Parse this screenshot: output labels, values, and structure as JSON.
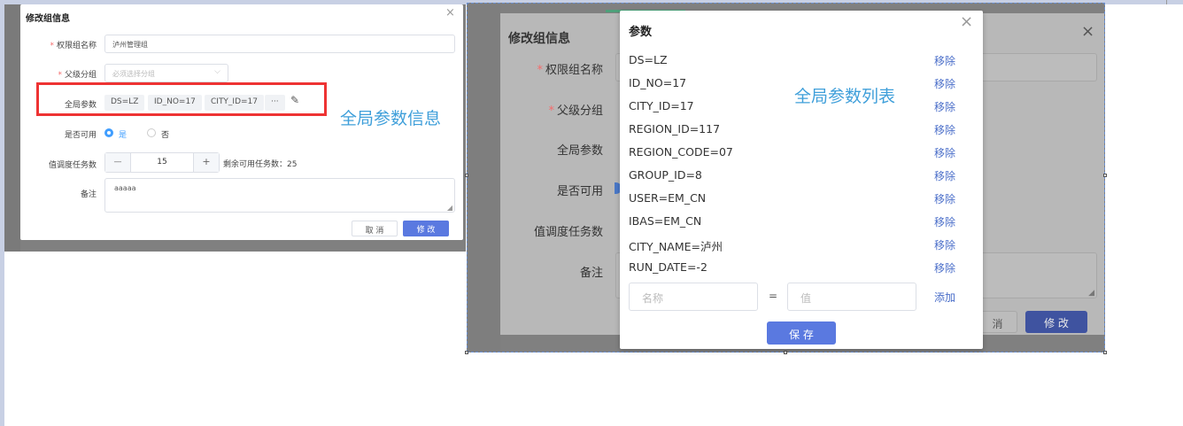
{
  "left_dialog": {
    "title": "修改组信息",
    "close_icon": "×",
    "name_label": "权限组名称",
    "name_value": "泸州管理组",
    "parent_label": "父级分组",
    "parent_placeholder": "必须选择分组",
    "chevron_icon": "⌵",
    "global_label": "全局参数",
    "tags": [
      "DS=LZ",
      "ID_NO=17",
      "CITY_ID=17"
    ],
    "more_label": "···",
    "edit_icon": "✎",
    "enabled_label": "是否可用",
    "radio_yes": "是",
    "radio_no": "否",
    "tasks_label": "值调度任务数",
    "minus": "—",
    "tasks_value": "15",
    "plus": "+",
    "remaining_text": "剩余可用任务数：25",
    "remark_label": "备注",
    "remark_value": "aaaaa",
    "cancel_label": "取 消",
    "modify_label": "修 改"
  },
  "callouts": {
    "global_info": "全局参数信息",
    "global_list": "全局参数列表"
  },
  "right_dialog": {
    "title": "修改组信息",
    "close_icon": "×",
    "name_label": "权限组名称",
    "parent_label": "父级分组",
    "global_label": "全局参数",
    "enabled_label": "是否可用",
    "tasks_label": "值调度任务数",
    "remark_label": "备注",
    "cancel_partial": "消",
    "modify_label": "修 改"
  },
  "param_modal": {
    "title": "参数",
    "close_icon": "×",
    "params": [
      "DS=LZ",
      "ID_NO=17",
      "CITY_ID=17",
      "REGION_ID=117",
      "REGION_CODE=07",
      "GROUP_ID=8",
      "USER=EM_CN",
      "IBAS=EM_CN",
      "CITY_NAME=泸州",
      "RUN_DATE=-2"
    ],
    "remove_label": "移除",
    "name_placeholder": "名称",
    "equals": "=",
    "value_placeholder": "值",
    "add_label": "添加",
    "save_label": "保 存"
  },
  "colors": {
    "primary": "#5a79e0",
    "highlight": "#ee3333",
    "callout": "#3f9fda",
    "link": "#4a6ec9"
  }
}
